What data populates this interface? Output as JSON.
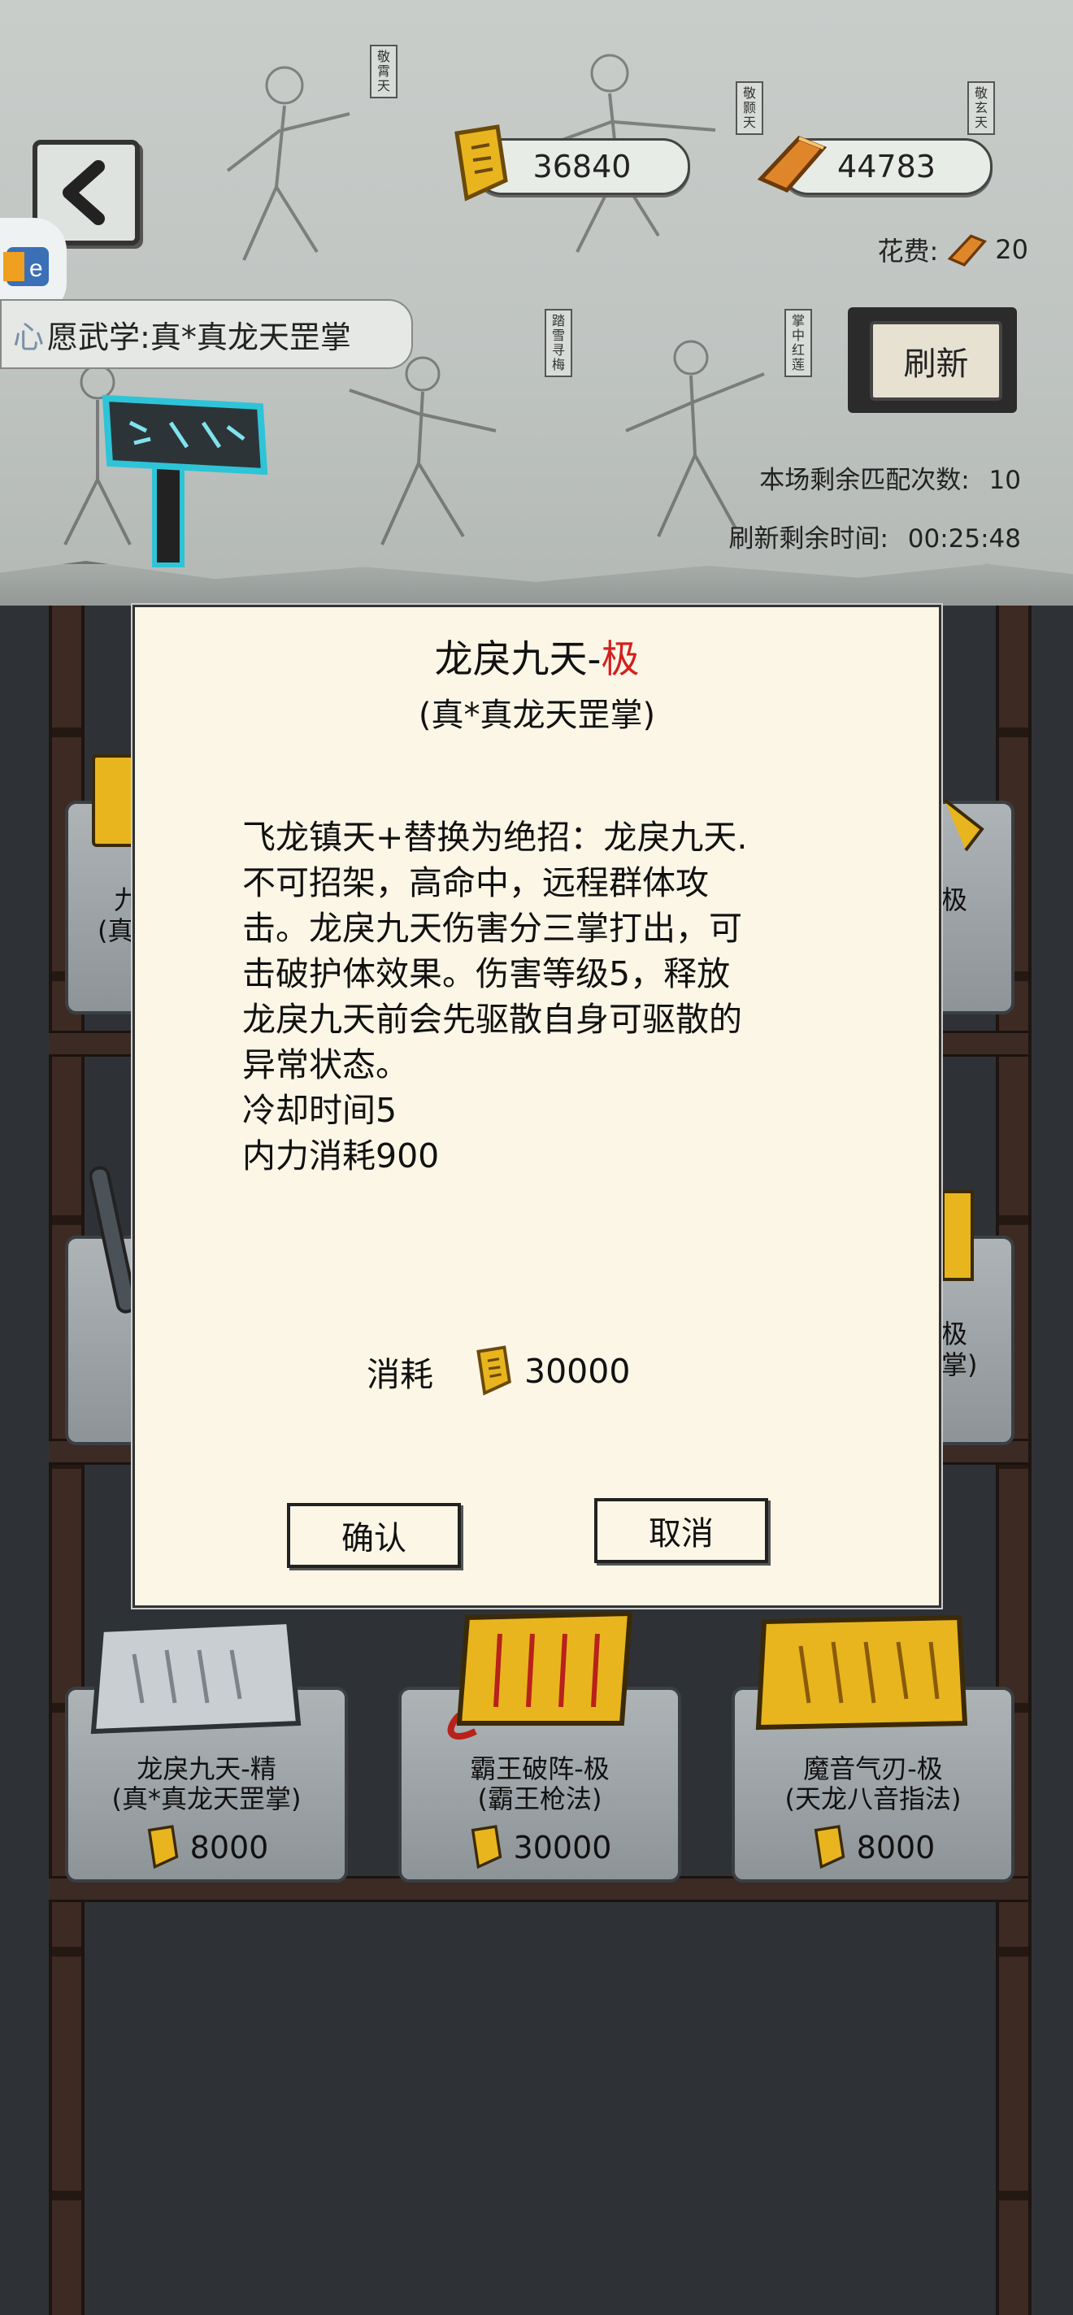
{
  "currency": {
    "scroll_amount": "36840",
    "gold_amount": "44783"
  },
  "cost": {
    "label": "花费:",
    "value": "20"
  },
  "refresh": {
    "label": "刷新"
  },
  "match": {
    "remaining_label": "本场剩余匹配次数:",
    "remaining_value": "10",
    "time_label": "刷新剩余时间:",
    "time_value": "00:25:48"
  },
  "wish": {
    "label": "愿武学:真*真龙天罡掌"
  },
  "app_badge": {
    "text": "心"
  },
  "mural_tags": [
    "敬霄天",
    "敬颢天",
    "敬玄天",
    "踏雪寻梅",
    "掌中红莲"
  ],
  "modal": {
    "title_main": "龙戾九天-",
    "title_grade": "极",
    "subtitle": "(真*真龙天罡掌)",
    "description": [
      "飞龙镇天+替换为绝招：龙戾九天.",
      "不可招架，高命中，远程群体攻",
      "击。龙戾九天伤害分三掌打出，可",
      "击破护体效果。伤害等级5，释放",
      "龙戾九天前会先驱散自身可驱散的",
      "异常状态。",
      "冷却时间5",
      "内力消耗900"
    ],
    "cost_label": "消耗",
    "cost_value": "30000",
    "confirm_label": "确认",
    "cancel_label": "取消"
  },
  "partial_texts": {
    "row1_left_a": "九",
    "row1_left_b": "(真",
    "row1_right": "极",
    "row2_right_a": "极",
    "row2_right_b": "掌)"
  },
  "items": [
    {
      "name": "龙戾九天-精",
      "school": "(真*真龙天罡掌)",
      "price": "8000"
    },
    {
      "name": "霸王破阵-极",
      "school": "(霸王枪法)",
      "price": "30000"
    },
    {
      "name": "魔音气刃-极",
      "school": "(天龙八音指法)",
      "price": "8000"
    }
  ],
  "colors": {
    "grade_red": "#d41f1f",
    "modal_bg": "#fbf6e6",
    "gold": "#e8b51e"
  }
}
